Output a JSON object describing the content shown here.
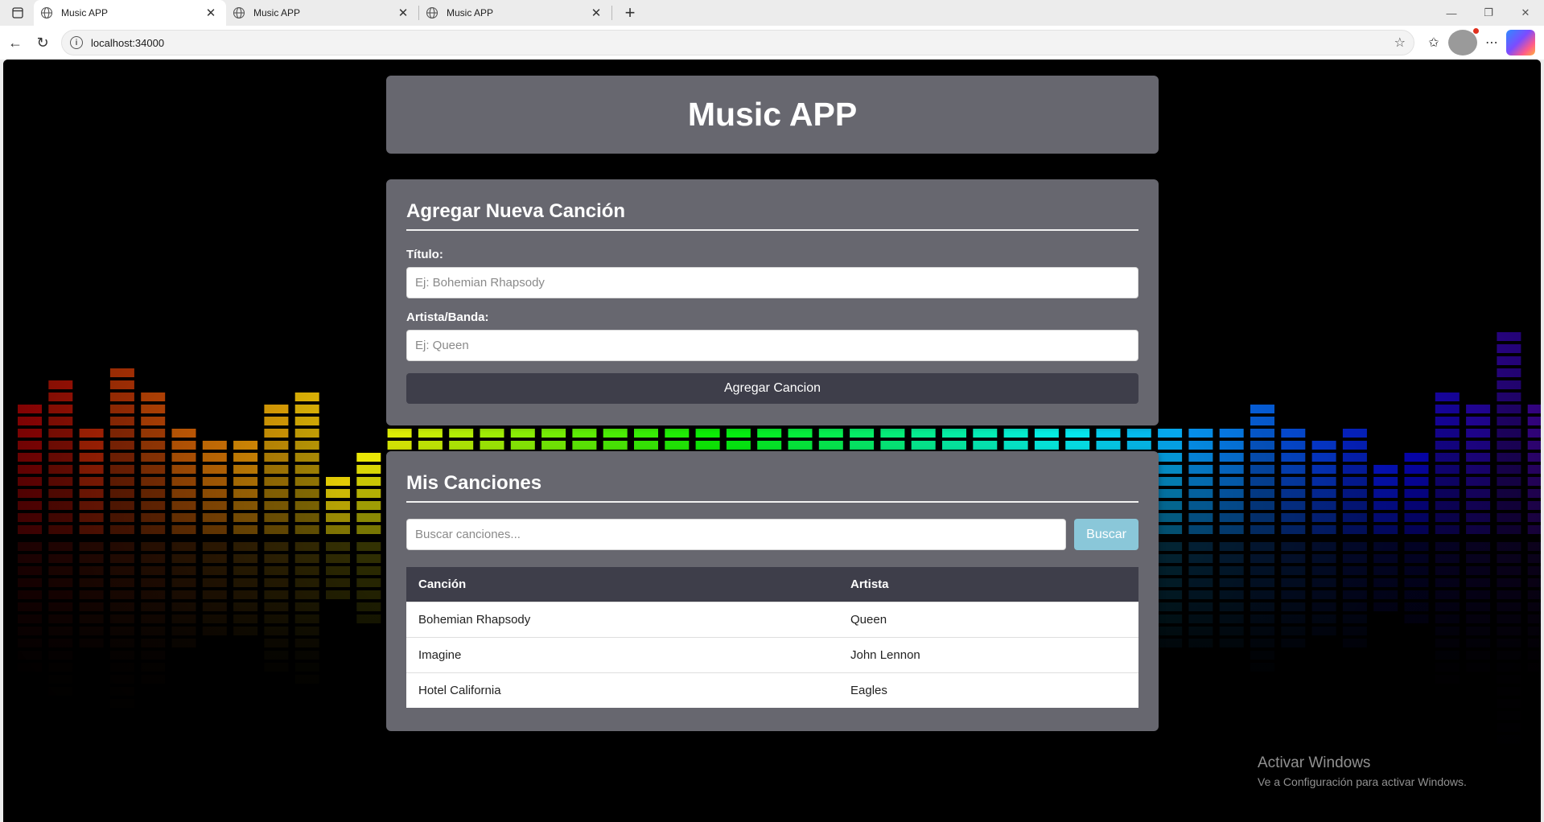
{
  "browser": {
    "tabs": [
      {
        "title": "Music APP",
        "active": true
      },
      {
        "title": "Music APP",
        "active": false
      },
      {
        "title": "Music APP",
        "active": false
      }
    ],
    "url": "localhost:34000"
  },
  "app": {
    "title": "Music APP",
    "form": {
      "heading": "Agregar Nueva Canción",
      "title_label": "Título:",
      "title_placeholder": "Ej: Bohemian Rhapsody",
      "artist_label": "Artista/Banda:",
      "artist_placeholder": "Ej: Queen",
      "submit_label": "Agregar Cancion"
    },
    "songs": {
      "heading": "Mis Canciones",
      "search_placeholder": "Buscar canciones...",
      "search_button": "Buscar",
      "columns": [
        "Canción",
        "Artista"
      ],
      "rows": [
        {
          "song": "Bohemian Rhapsody",
          "artist": "Queen"
        },
        {
          "song": "Imagine",
          "artist": "John Lennon"
        },
        {
          "song": "Hotel California",
          "artist": "Eagles"
        }
      ]
    }
  },
  "watermark": {
    "line1": "Activar Windows",
    "line2": "Ve a Configuración para activar Windows."
  },
  "colors": {
    "card": "#67676f",
    "dark": "#3e3e4a",
    "search_button": "#8ac7d9"
  }
}
